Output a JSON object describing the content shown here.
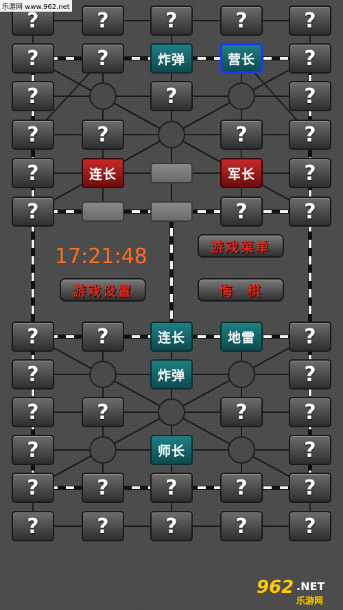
{
  "colors": {
    "accent_timer": "#ff6d1f",
    "menu_text": "#e1261c",
    "selected_border": "#1b36ff",
    "teal_piece": "#1f7f84",
    "red_piece": "#c42a2a"
  },
  "icons": {
    "hidden": "question-mark-icon"
  },
  "hidden_label": "?",
  "timer": "17:21:48",
  "buttons": {
    "settings": "游戏设置",
    "menu": "游戏菜单",
    "undo": "悔  棋"
  },
  "watermark": {
    "top": "乐游网 www.962.net",
    "bottom_num": "962",
    "bottom_net": ".NET",
    "bottom_cn": "乐游网"
  },
  "grid": {
    "rows": [
      [
        "hidden",
        "hidden",
        "hidden",
        "hidden",
        "hidden"
      ],
      [
        "hidden",
        "hidden",
        "teal:炸弹",
        "teal:营长:sel",
        "hidden"
      ],
      [
        "hidden",
        "camp",
        "hidden",
        "camp",
        "hidden"
      ],
      [
        "hidden",
        "hidden",
        "camp",
        "hidden",
        "hidden"
      ],
      [
        "hidden",
        "red:连长",
        "empty",
        "red:军长",
        "hidden"
      ],
      [
        "hidden",
        "empty",
        "empty",
        "hidden",
        "hidden"
      ],
      [
        "hidden",
        "hidden",
        "teal:连长",
        "teal:地雷",
        "hidden"
      ],
      [
        "hidden",
        "camp",
        "teal:炸弹",
        "camp",
        "hidden"
      ],
      [
        "hidden",
        "hidden",
        "camp",
        "hidden",
        "hidden"
      ],
      [
        "hidden",
        "camp",
        "teal:师长",
        "camp",
        "hidden"
      ],
      [
        "hidden",
        "hidden",
        "hidden",
        "hidden",
        "hidden"
      ],
      [
        "hidden",
        "hidden",
        "hidden",
        "hidden",
        "hidden"
      ]
    ]
  }
}
